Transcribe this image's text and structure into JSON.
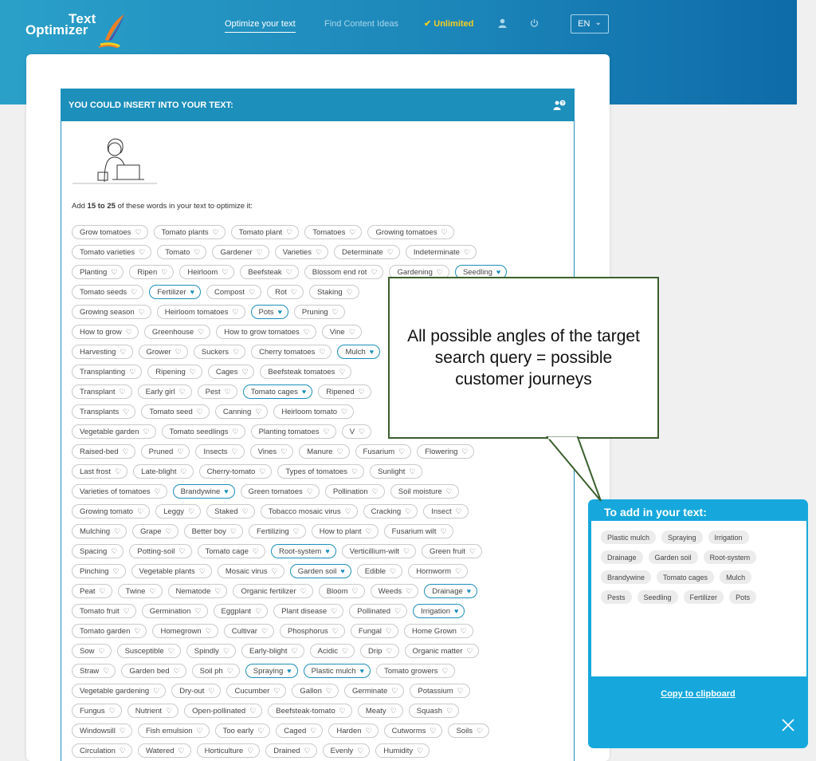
{
  "header": {
    "logo_line1": "Text",
    "logo_line2": "Optimizer",
    "nav": {
      "optimize": "Optimize your text",
      "ideas": "Find Content Ideas",
      "unlimited": "✔ Unlimited"
    },
    "user_icon": "user-icon",
    "power_icon": "power-icon",
    "lang": "EN",
    "lang_chevron": "⌄"
  },
  "panel": {
    "title": "YOU COULD INSERT INTO YOUR TEXT:",
    "help_icon": "help-chat-icon",
    "instr_pre": "Add ",
    "instr_range": "15 to 25",
    "instr_post": " of these words in your text to optimize it:"
  },
  "chip_rows": [
    [
      [
        "Grow tomatoes",
        0
      ],
      [
        "Tomato plants",
        0
      ],
      [
        "Tomato plant",
        0
      ],
      [
        "Tomatoes",
        0
      ],
      [
        "Growing tomatoes",
        0
      ]
    ],
    [
      [
        "Tomato varieties",
        0
      ],
      [
        "Tomato",
        0
      ],
      [
        "Gardener",
        0
      ],
      [
        "Varieties",
        0
      ],
      [
        "Determinate",
        0
      ],
      [
        "Indeterminate",
        0
      ]
    ],
    [
      [
        "Planting",
        0
      ],
      [
        "Ripen",
        0
      ],
      [
        "Heirloom",
        0
      ],
      [
        "Beefsteak",
        0
      ],
      [
        "Blossom end rot",
        0
      ],
      [
        "Gardening",
        0
      ],
      [
        "Seedling",
        1
      ]
    ],
    [
      [
        "Tomato seeds",
        0
      ],
      [
        "Fertilizer",
        1
      ],
      [
        "Compost",
        0
      ],
      [
        "Rot",
        0
      ],
      [
        "Staking",
        0
      ]
    ],
    [
      [
        "Growing season",
        0
      ],
      [
        "Heirloom tomatoes",
        0
      ],
      [
        "Pots",
        1
      ],
      [
        "Pruning",
        0
      ]
    ],
    [
      [
        "How to grow",
        0
      ],
      [
        "Greenhouse",
        0
      ],
      [
        "How to grow tomatoes",
        0
      ],
      [
        "Vine",
        0
      ]
    ],
    [
      [
        "Harvesting",
        0
      ],
      [
        "Grower",
        0
      ],
      [
        "Suckers",
        0
      ],
      [
        "Cherry tomatoes",
        0
      ],
      [
        "Mulch",
        1
      ]
    ],
    [
      [
        "Transplanting",
        0
      ],
      [
        "Ripening",
        0
      ],
      [
        "Cages",
        0
      ],
      [
        "Beefsteak tomatoes",
        0
      ]
    ],
    [
      [
        "Transplant",
        0
      ],
      [
        "Early girl",
        0
      ],
      [
        "Pest",
        0
      ],
      [
        "Tomato cages",
        1
      ],
      [
        "Ripened",
        0
      ]
    ],
    [
      [
        "Transplants",
        0
      ],
      [
        "Tomato seed",
        0
      ],
      [
        "Canning",
        0
      ],
      [
        "Heirloom tomato",
        0
      ]
    ],
    [
      [
        "Vegetable garden",
        0
      ],
      [
        "Tomato seedlings",
        0
      ],
      [
        "Planting tomatoes",
        0
      ],
      [
        "V",
        0
      ]
    ],
    [
      [
        "Raised-bed",
        0
      ],
      [
        "Pruned",
        0
      ],
      [
        "Insects",
        0
      ],
      [
        "Vines",
        0
      ],
      [
        "Manure",
        0
      ],
      [
        "Fusarium",
        0
      ],
      [
        "Flowering",
        0
      ]
    ],
    [
      [
        "Last frost",
        0
      ],
      [
        "Late-blight",
        0
      ],
      [
        "Cherry-tomato",
        0
      ],
      [
        "Types of tomatoes",
        0
      ],
      [
        "Sunlight",
        0
      ]
    ],
    [
      [
        "Varieties of tomatoes",
        0
      ],
      [
        "Brandywine",
        1
      ],
      [
        "Green tomatoes",
        0
      ],
      [
        "Pollination",
        0
      ],
      [
        "Soil moisture",
        0
      ]
    ],
    [
      [
        "Growing tomato",
        0
      ],
      [
        "Leggy",
        0
      ],
      [
        "Staked",
        0
      ],
      [
        "Tobacco mosaic virus",
        0
      ],
      [
        "Cracking",
        0
      ],
      [
        "Insect",
        0
      ]
    ],
    [
      [
        "Mulching",
        0
      ],
      [
        "Grape",
        0
      ],
      [
        "Better boy",
        0
      ],
      [
        "Fertilizing",
        0
      ],
      [
        "How to plant",
        0
      ],
      [
        "Fusarium wilt",
        0
      ]
    ],
    [
      [
        "Spacing",
        0
      ],
      [
        "Potting-soil",
        0
      ],
      [
        "Tomato cage",
        0
      ],
      [
        "Root-system",
        1
      ],
      [
        "Verticillium-wilt",
        0
      ],
      [
        "Green fruit",
        0
      ]
    ],
    [
      [
        "Pinching",
        0
      ],
      [
        "Vegetable plants",
        0
      ],
      [
        "Mosaic virus",
        0
      ],
      [
        "Garden soil",
        1
      ],
      [
        "Edible",
        0
      ],
      [
        "Hornworm",
        0
      ]
    ],
    [
      [
        "Peat",
        0
      ],
      [
        "Twine",
        0
      ],
      [
        "Nematode",
        0
      ],
      [
        "Organic fertilizer",
        0
      ],
      [
        "Bloom",
        0
      ],
      [
        "Weeds",
        0
      ],
      [
        "Drainage",
        1
      ]
    ],
    [
      [
        "Tomato fruit",
        0
      ],
      [
        "Germination",
        0
      ],
      [
        "Eggplant",
        0
      ],
      [
        "Plant disease",
        0
      ],
      [
        "Pollinated",
        0
      ],
      [
        "Irrigation",
        1
      ]
    ],
    [
      [
        "Tomato garden",
        0
      ],
      [
        "Homegrown",
        0
      ],
      [
        "Cultivar",
        0
      ],
      [
        "Phosphorus",
        0
      ],
      [
        "Fungal",
        0
      ],
      [
        "Home Grown",
        0
      ]
    ],
    [
      [
        "Sow",
        0
      ],
      [
        "Susceptible",
        0
      ],
      [
        "Spindly",
        0
      ],
      [
        "Early-blight",
        0
      ],
      [
        "Acidic",
        0
      ],
      [
        "Drip",
        0
      ],
      [
        "Organic matter",
        0
      ]
    ],
    [
      [
        "Straw",
        0
      ],
      [
        "Garden bed",
        0
      ],
      [
        "Soil ph",
        0
      ],
      [
        "Spraying",
        1
      ],
      [
        "Plastic mulch",
        1
      ],
      [
        "Tomato growers",
        0
      ]
    ],
    [
      [
        "Vegetable gardening",
        0
      ],
      [
        "Dry-out",
        0
      ],
      [
        "Cucumber",
        0
      ],
      [
        "Gallon",
        0
      ],
      [
        "Germinate",
        0
      ],
      [
        "Potassium",
        0
      ]
    ],
    [
      [
        "Fungus",
        0
      ],
      [
        "Nutrient",
        0
      ],
      [
        "Open-pollinated",
        0
      ],
      [
        "Beefsteak-tomato",
        0
      ],
      [
        "Meaty",
        0
      ],
      [
        "Squash",
        0
      ]
    ],
    [
      [
        "Windowsill",
        0
      ],
      [
        "Fish emulsion",
        0
      ],
      [
        "Too early",
        0
      ],
      [
        "Caged",
        0
      ],
      [
        "Harden",
        0
      ],
      [
        "Cutworms",
        0
      ],
      [
        "Soils",
        0
      ]
    ],
    [
      [
        "Circulation",
        0
      ],
      [
        "Watered",
        0
      ],
      [
        "Horticulture",
        0
      ],
      [
        "Drained",
        0
      ],
      [
        "Evenly",
        0
      ],
      [
        "Humidity",
        0
      ]
    ]
  ],
  "callout": {
    "text": "All possible angles of the target search query = possible customer journeys"
  },
  "add_box": {
    "title": "To add in your text:",
    "rows": [
      [
        "Plastic mulch",
        "Spraying",
        "Irrigation"
      ],
      [
        "Drainage",
        "Garden soil",
        "Root-system"
      ],
      [
        "Brandywine",
        "Tomato cages",
        "Mulch"
      ],
      [
        "Pests",
        "Seedling",
        "Fertilizer",
        "Pots"
      ]
    ],
    "copy": "Copy to clipboard",
    "close_icon": "close-icon"
  },
  "colors": {
    "brand": "#1d8fbb",
    "accent": "#16a8dc",
    "unlimited": "#f3cf22",
    "callout_border": "#3a5f2d"
  }
}
